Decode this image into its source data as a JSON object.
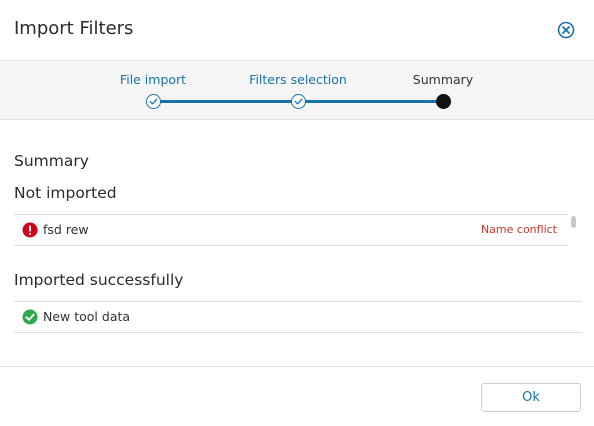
{
  "dialog": {
    "title": "Import Filters",
    "close_icon": "close-circle-icon"
  },
  "stepper": {
    "accent_color": "#1a73a8",
    "steps": [
      {
        "label": "File import",
        "state": "done",
        "icon": "check-icon"
      },
      {
        "label": "Filters selection",
        "state": "done",
        "icon": "check-icon"
      },
      {
        "label": "Summary",
        "state": "current"
      }
    ]
  },
  "summary": {
    "heading": "Summary",
    "not_imported": {
      "heading": "Not imported",
      "items": [
        {
          "name": "fsd rew",
          "status": "Name conflict",
          "icon": "error-icon",
          "icon_color": "#d0021b"
        }
      ]
    },
    "imported": {
      "heading": "Imported successfully",
      "items": [
        {
          "name": "New tool data",
          "icon": "success-check-icon",
          "icon_color": "#2fa84f"
        }
      ]
    }
  },
  "footer": {
    "ok_label": "Ok"
  }
}
